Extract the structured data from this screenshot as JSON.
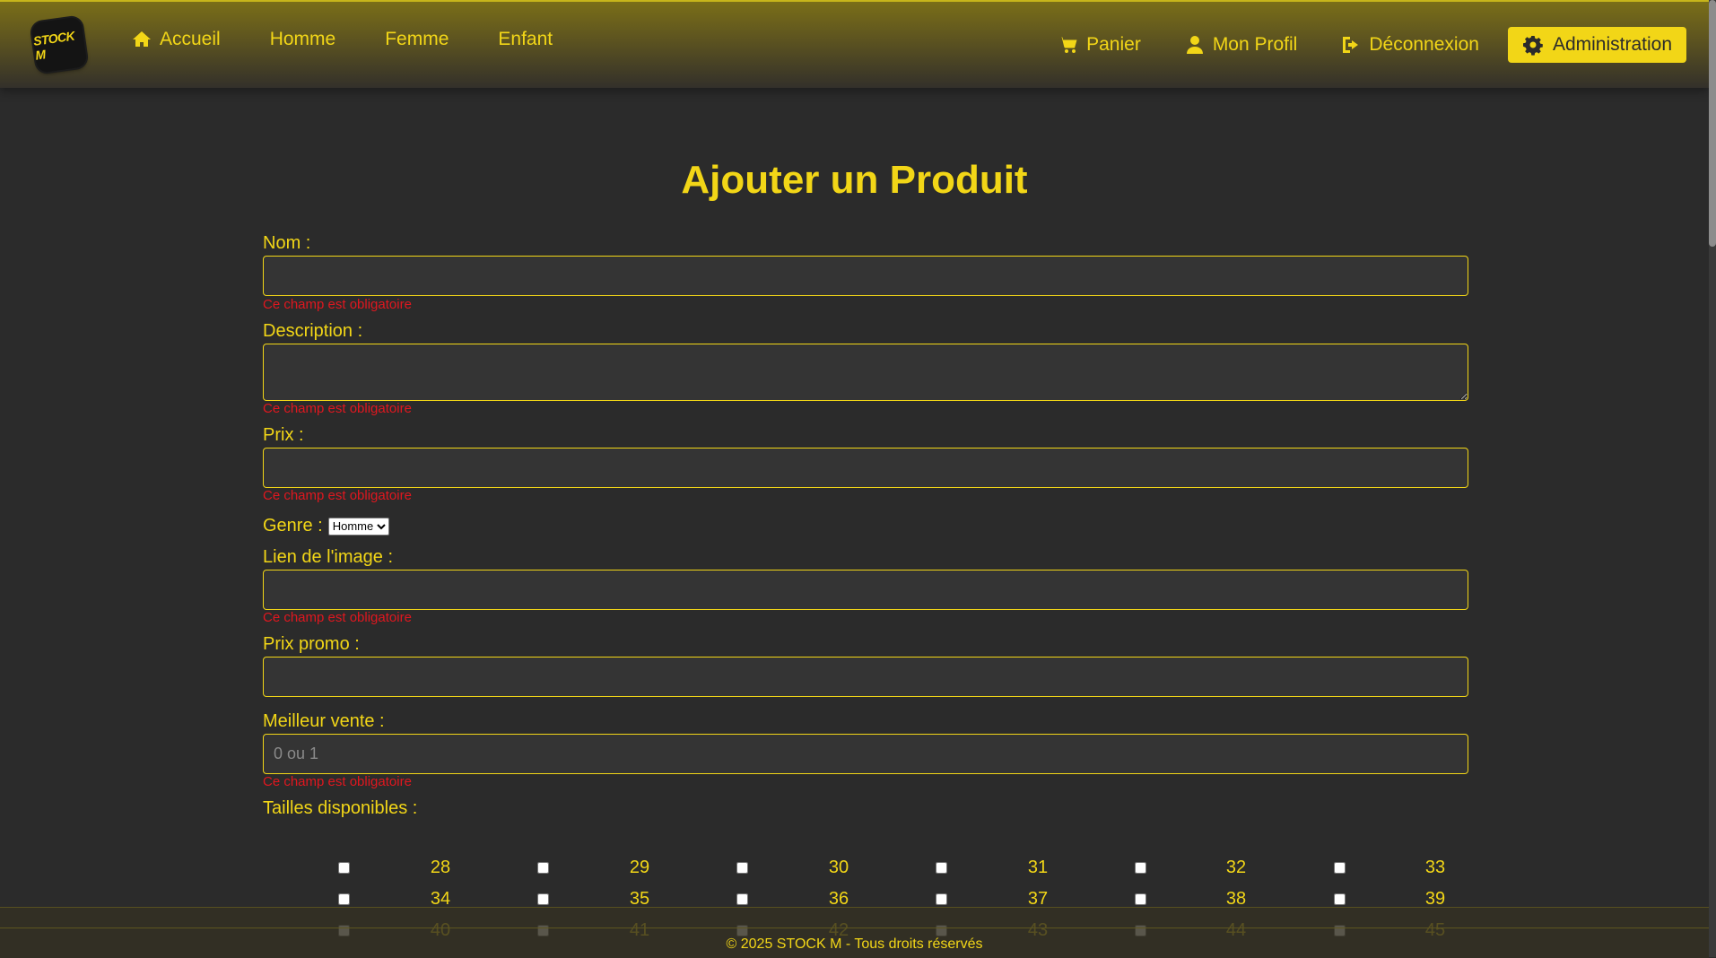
{
  "nav": {
    "logo_text": "STOCK M",
    "left": [
      {
        "label": "Accueil",
        "icon": "home-icon"
      },
      {
        "label": "Homme"
      },
      {
        "label": "Femme"
      },
      {
        "label": "Enfant"
      }
    ],
    "right": [
      {
        "label": "Panier",
        "icon": "cart-icon"
      },
      {
        "label": "Mon Profil",
        "icon": "user-icon"
      },
      {
        "label": "Déconnexion",
        "icon": "logout-icon"
      }
    ],
    "admin": {
      "label": "Administration",
      "icon": "gear-icon"
    }
  },
  "page": {
    "title": "Ajouter un Produit"
  },
  "form": {
    "nom": {
      "label": "Nom :",
      "value": "",
      "error": "Ce champ est obligatoire"
    },
    "description": {
      "label": "Description :",
      "value": "",
      "error": "Ce champ est obligatoire"
    },
    "prix": {
      "label": "Prix :",
      "value": "",
      "error": "Ce champ est obligatoire"
    },
    "genre": {
      "label": "Genre :",
      "selected": "Homme"
    },
    "image": {
      "label": "Lien de l'image :",
      "value": "",
      "error": "Ce champ est obligatoire"
    },
    "prix_promo": {
      "label": "Prix promo :",
      "value": ""
    },
    "meilleur_vente": {
      "label": "Meilleur vente :",
      "placeholder": "0 ou 1",
      "value": "",
      "error": "Ce champ est obligatoire"
    },
    "tailles": {
      "label": "Tailles disponibles :",
      "rows": [
        [
          "28",
          "29",
          "30",
          "31",
          "32",
          "33"
        ],
        [
          "34",
          "35",
          "36",
          "37",
          "38",
          "39"
        ],
        [
          "40",
          "41",
          "42",
          "43",
          "44",
          "45"
        ]
      ]
    }
  },
  "footer": {
    "text": "© 2025 STOCK M - Tous droits réservés"
  },
  "colors": {
    "accent": "#f2d617",
    "background": "#2b2b2b",
    "error": "#e0171f"
  }
}
